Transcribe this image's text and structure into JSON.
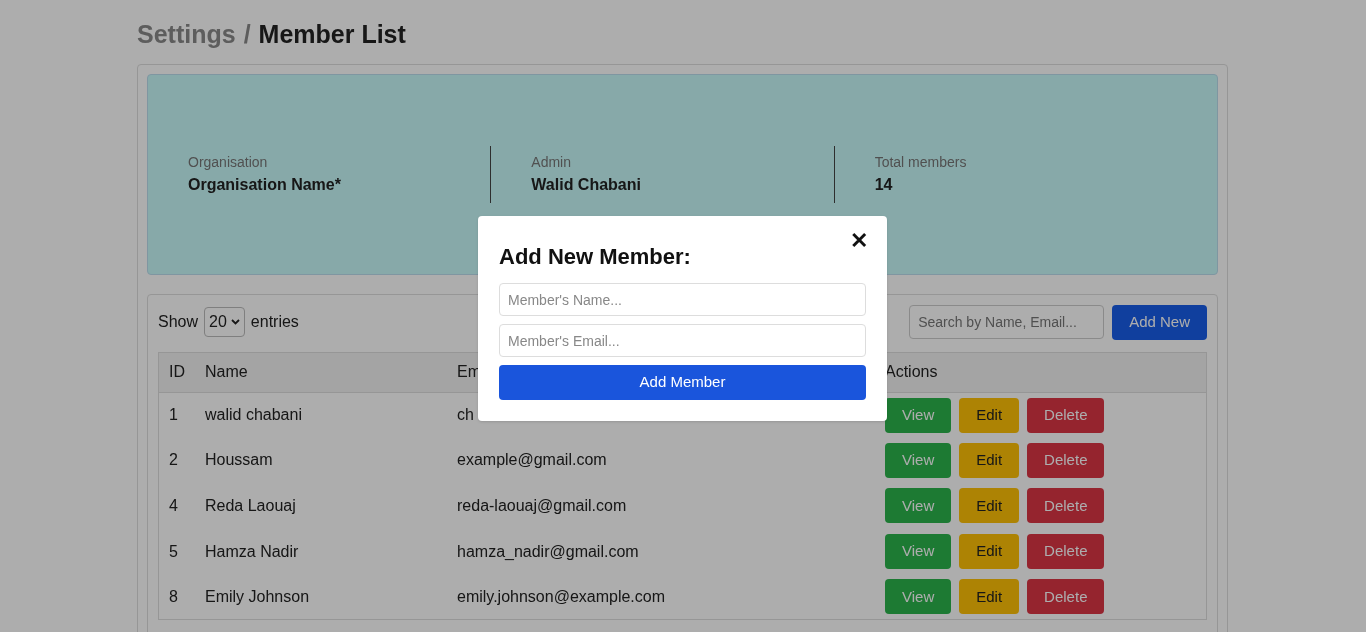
{
  "breadcrumb": {
    "parent": "Settings",
    "separator": "/",
    "current": "Member List"
  },
  "summary": [
    {
      "label": "Organisation",
      "value": "Organisation Name*"
    },
    {
      "label": "Admin",
      "value": "Walid Chabani"
    },
    {
      "label": "Total members",
      "value": "14"
    }
  ],
  "table_controls": {
    "show_label": "Show",
    "page_size": "20",
    "entries_label": "entries",
    "search": {
      "placeholder": "Search by Name, Email..."
    },
    "add_button": "Add New"
  },
  "table": {
    "columns": [
      "ID",
      "Name",
      "Em",
      "Actions"
    ],
    "rows": [
      {
        "id": "1",
        "name": "walid chabani",
        "email": "ch",
        "actions": [
          {
            "kind": "view",
            "label": "View"
          },
          {
            "kind": "edit",
            "label": "Edit"
          },
          {
            "kind": "delete",
            "label": "Delete"
          }
        ]
      },
      {
        "id": "2",
        "name": "Houssam",
        "email": "example@gmail.com",
        "actions": [
          {
            "kind": "view",
            "label": "View"
          },
          {
            "kind": "edit",
            "label": "Edit"
          },
          {
            "kind": "delete",
            "label": "Delete"
          }
        ]
      },
      {
        "id": "4",
        "name": "Reda Laouaj",
        "email": "reda-laouaj@gmail.com",
        "actions": [
          {
            "kind": "view",
            "label": "View"
          },
          {
            "kind": "edit",
            "label": "Edit"
          },
          {
            "kind": "delete",
            "label": "Delete"
          }
        ]
      },
      {
        "id": "5",
        "name": "Hamza Nadir",
        "email": "hamza_nadir@gmail.com",
        "actions": [
          {
            "kind": "view",
            "label": "View"
          },
          {
            "kind": "edit",
            "label": "Edit"
          },
          {
            "kind": "delete",
            "label": "Delete"
          }
        ]
      },
      {
        "id": "8",
        "name": "Emily Johnson",
        "email": "emily.johnson@example.com",
        "actions": [
          {
            "kind": "view",
            "label": "View"
          },
          {
            "kind": "edit",
            "label": "Edit"
          },
          {
            "kind": "delete",
            "label": "Delete"
          }
        ]
      }
    ]
  },
  "modal": {
    "title": "Add New Member:",
    "close": "✕",
    "fields": [
      {
        "placeholder": "Member's Name..."
      },
      {
        "placeholder": "Member's Email..."
      }
    ],
    "submit": "Add Member"
  }
}
